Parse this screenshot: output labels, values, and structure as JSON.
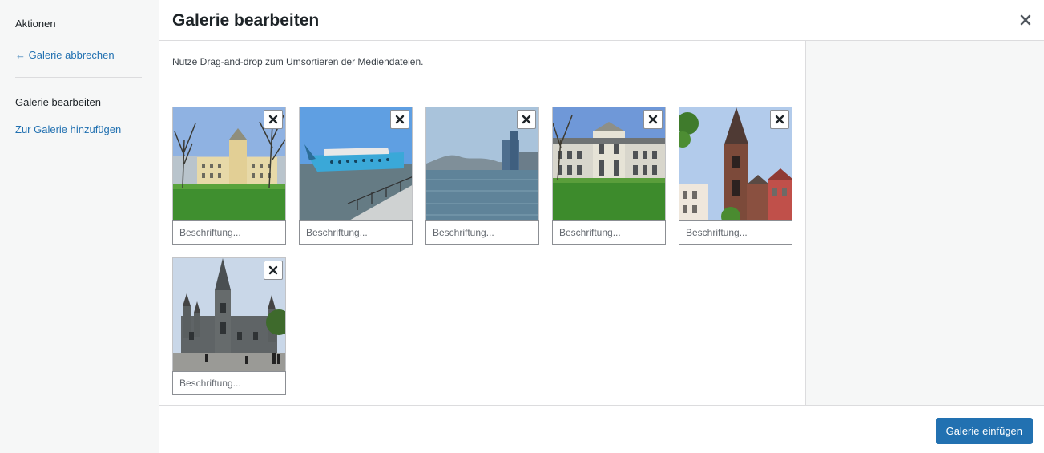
{
  "sidebar": {
    "heading": "Aktionen",
    "cancel_link": "← Galerie abbrechen",
    "active_item": "Galerie bearbeiten",
    "add_link": "Zur Galerie hinzufügen"
  },
  "header": {
    "title": "Galerie bearbeiten"
  },
  "content": {
    "instructions": "Nutze Drag-and-drop zum Umsortieren der Mediendateien."
  },
  "attachments": [
    {
      "caption_placeholder": "Beschriftung..."
    },
    {
      "caption_placeholder": "Beschriftung..."
    },
    {
      "caption_placeholder": "Beschriftung..."
    },
    {
      "caption_placeholder": "Beschriftung..."
    },
    {
      "caption_placeholder": "Beschriftung..."
    },
    {
      "caption_placeholder": "Beschriftung..."
    }
  ],
  "footer": {
    "insert_button": "Galerie einfügen"
  },
  "colors": {
    "accent": "#2271b1",
    "sidebar_bg": "#f6f7f7",
    "border": "#dcdcde"
  }
}
